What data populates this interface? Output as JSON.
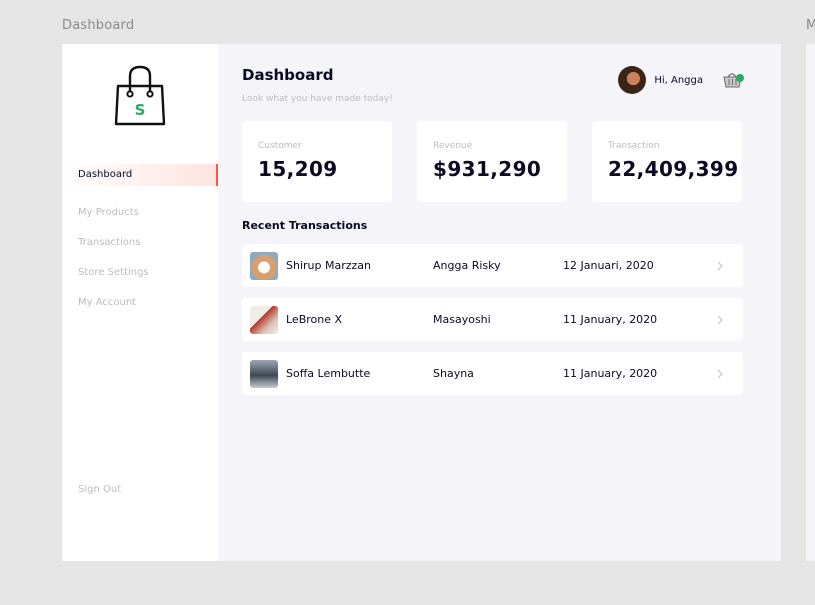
{
  "frame_label": "Dashboard",
  "frame_label_right": "M",
  "colors": {
    "accent": "#f35a45",
    "logo_green": "#29a867",
    "text_dark": "#0a0a23",
    "muted": "#bdbdbd"
  },
  "logo": {
    "letter": "S",
    "icon": "shopping-bag-icon"
  },
  "sidebar": {
    "items": [
      {
        "label": "Dashboard",
        "active": true
      },
      {
        "label": "My Products",
        "active": false
      },
      {
        "label": "Transactions",
        "active": false
      },
      {
        "label": "Store Settings",
        "active": false
      },
      {
        "label": "My Account",
        "active": false
      }
    ],
    "signout_label": "Sign Out"
  },
  "header": {
    "title": "Dashboard",
    "subtitle": "Look what you have made today!",
    "greeting": "Hi, Angga",
    "cart_icon": "cart-icon"
  },
  "stats": [
    {
      "label": "Customer",
      "value": "15,209"
    },
    {
      "label": "Revenue",
      "value": "$931,290"
    },
    {
      "label": "Transaction",
      "value": "22,409,399"
    }
  ],
  "recent": {
    "title": "Recent Transactions",
    "rows": [
      {
        "product": "Shirup Marzzan",
        "buyer": "Angga Risky",
        "date": "12 Januari, 2020"
      },
      {
        "product": "LeBrone X",
        "buyer": "Masayoshi",
        "date": "11 January, 2020"
      },
      {
        "product": "Soffa Lembutte",
        "buyer": "Shayna",
        "date": "11 January, 2020"
      }
    ]
  }
}
